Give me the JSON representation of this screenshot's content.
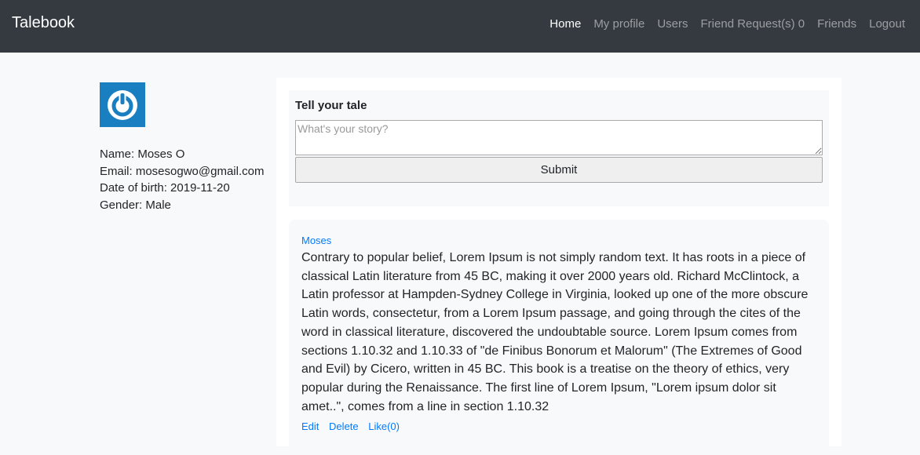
{
  "app": {
    "brand": "Talebook"
  },
  "nav": {
    "items": [
      {
        "label": "Home"
      },
      {
        "label": "My profile"
      },
      {
        "label": "Users"
      },
      {
        "label": "Friend Request(s) 0"
      },
      {
        "label": "Friends"
      },
      {
        "label": "Logout"
      }
    ]
  },
  "profile": {
    "avatar_icon": "power-icon",
    "avatar_color": "#1a7fc1",
    "name": "Name: Moses O",
    "email": "Email: mosesogwo@gmail.com",
    "dob": "Date of birth: 2019-11-20",
    "gender": "Gender: Male"
  },
  "composer": {
    "title": "Tell your tale",
    "placeholder": "What's your story?",
    "value": "",
    "submit_label": "Submit"
  },
  "posts": [
    {
      "author": "Moses",
      "body": "Contrary to popular belief, Lorem Ipsum is not simply random text. It has roots in a piece of classical Latin literature from 45 BC, making it over 2000 years old. Richard McClintock, a Latin professor at Hampden-Sydney College in Virginia, looked up one of the more obscure Latin words, consectetur, from a Lorem Ipsum passage, and going through the cites of the word in classical literature, discovered the undoubtable source. Lorem Ipsum comes from sections 1.10.32 and 1.10.33 of \"de Finibus Bonorum et Malorum\" (The Extremes of Good and Evil) by Cicero, written in 45 BC. This book is a treatise on the theory of ethics, very popular during the Renaissance. The first line of Lorem Ipsum, \"Lorem ipsum dolor sit amet..\", comes from a line in section 1.10.32",
      "actions": {
        "edit": "Edit",
        "delete": "Delete",
        "like": "Like(0)"
      }
    }
  ],
  "colors": {
    "navbar": "#343a40",
    "link": "#007bff",
    "background": "#f8f9fa"
  }
}
